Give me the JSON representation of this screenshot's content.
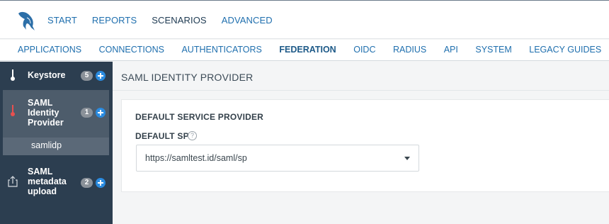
{
  "topnav": {
    "items": [
      {
        "label": "START"
      },
      {
        "label": "REPORTS"
      },
      {
        "label": "SCENARIOS"
      },
      {
        "label": "ADVANCED"
      }
    ]
  },
  "subnav": {
    "items": [
      {
        "label": "APPLICATIONS"
      },
      {
        "label": "CONNECTIONS"
      },
      {
        "label": "AUTHENTICATORS"
      },
      {
        "label": "FEDERATION"
      },
      {
        "label": "OIDC"
      },
      {
        "label": "RADIUS"
      },
      {
        "label": "API"
      },
      {
        "label": "SYSTEM"
      },
      {
        "label": "LEGACY GUIDES"
      }
    ]
  },
  "sidebar": {
    "keystore": {
      "label": "Keystore",
      "count": "5"
    },
    "saml_idp": {
      "label": "SAML Identity Provider",
      "count": "1",
      "child": "samlidp"
    },
    "saml_upload": {
      "label": "SAML metadata upload",
      "count": "2"
    }
  },
  "main": {
    "title": "SAML IDENTITY PROVIDER",
    "section": "DEFAULT SERVICE PROVIDER",
    "field_label": "DEFAULT SP",
    "help_glyph": "?",
    "select_value": "https://samltest.id/saml/sp"
  },
  "colors": {
    "accent": "#1f6fae",
    "sidebar_bg": "#2c3e50",
    "plus": "#2a8be0",
    "active_icon": "#e8504f"
  }
}
